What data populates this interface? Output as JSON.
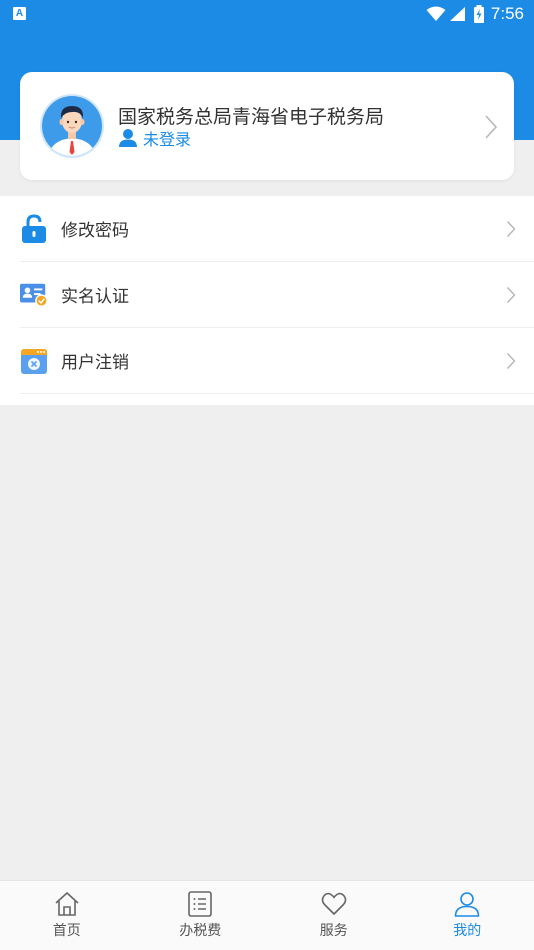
{
  "status_bar": {
    "app_icon_letter": "A",
    "time": "7:56"
  },
  "profile": {
    "title": "国家税务总局青海省电子税务局",
    "login_status": "未登录"
  },
  "menu": {
    "items": [
      {
        "label": "修改密码",
        "icon": "lock-icon"
      },
      {
        "label": "实名认证",
        "icon": "id-card-icon"
      },
      {
        "label": "用户注销",
        "icon": "cancel-account-icon"
      }
    ]
  },
  "tabs": [
    {
      "label": "首页",
      "icon": "home-icon",
      "active": false
    },
    {
      "label": "办税费",
      "icon": "list-icon",
      "active": false
    },
    {
      "label": "服务",
      "icon": "heart-icon",
      "active": false
    },
    {
      "label": "我的",
      "icon": "user-icon",
      "active": true
    }
  ],
  "colors": {
    "primary": "#1b8be6",
    "background": "#efefef",
    "text": "#333333"
  }
}
